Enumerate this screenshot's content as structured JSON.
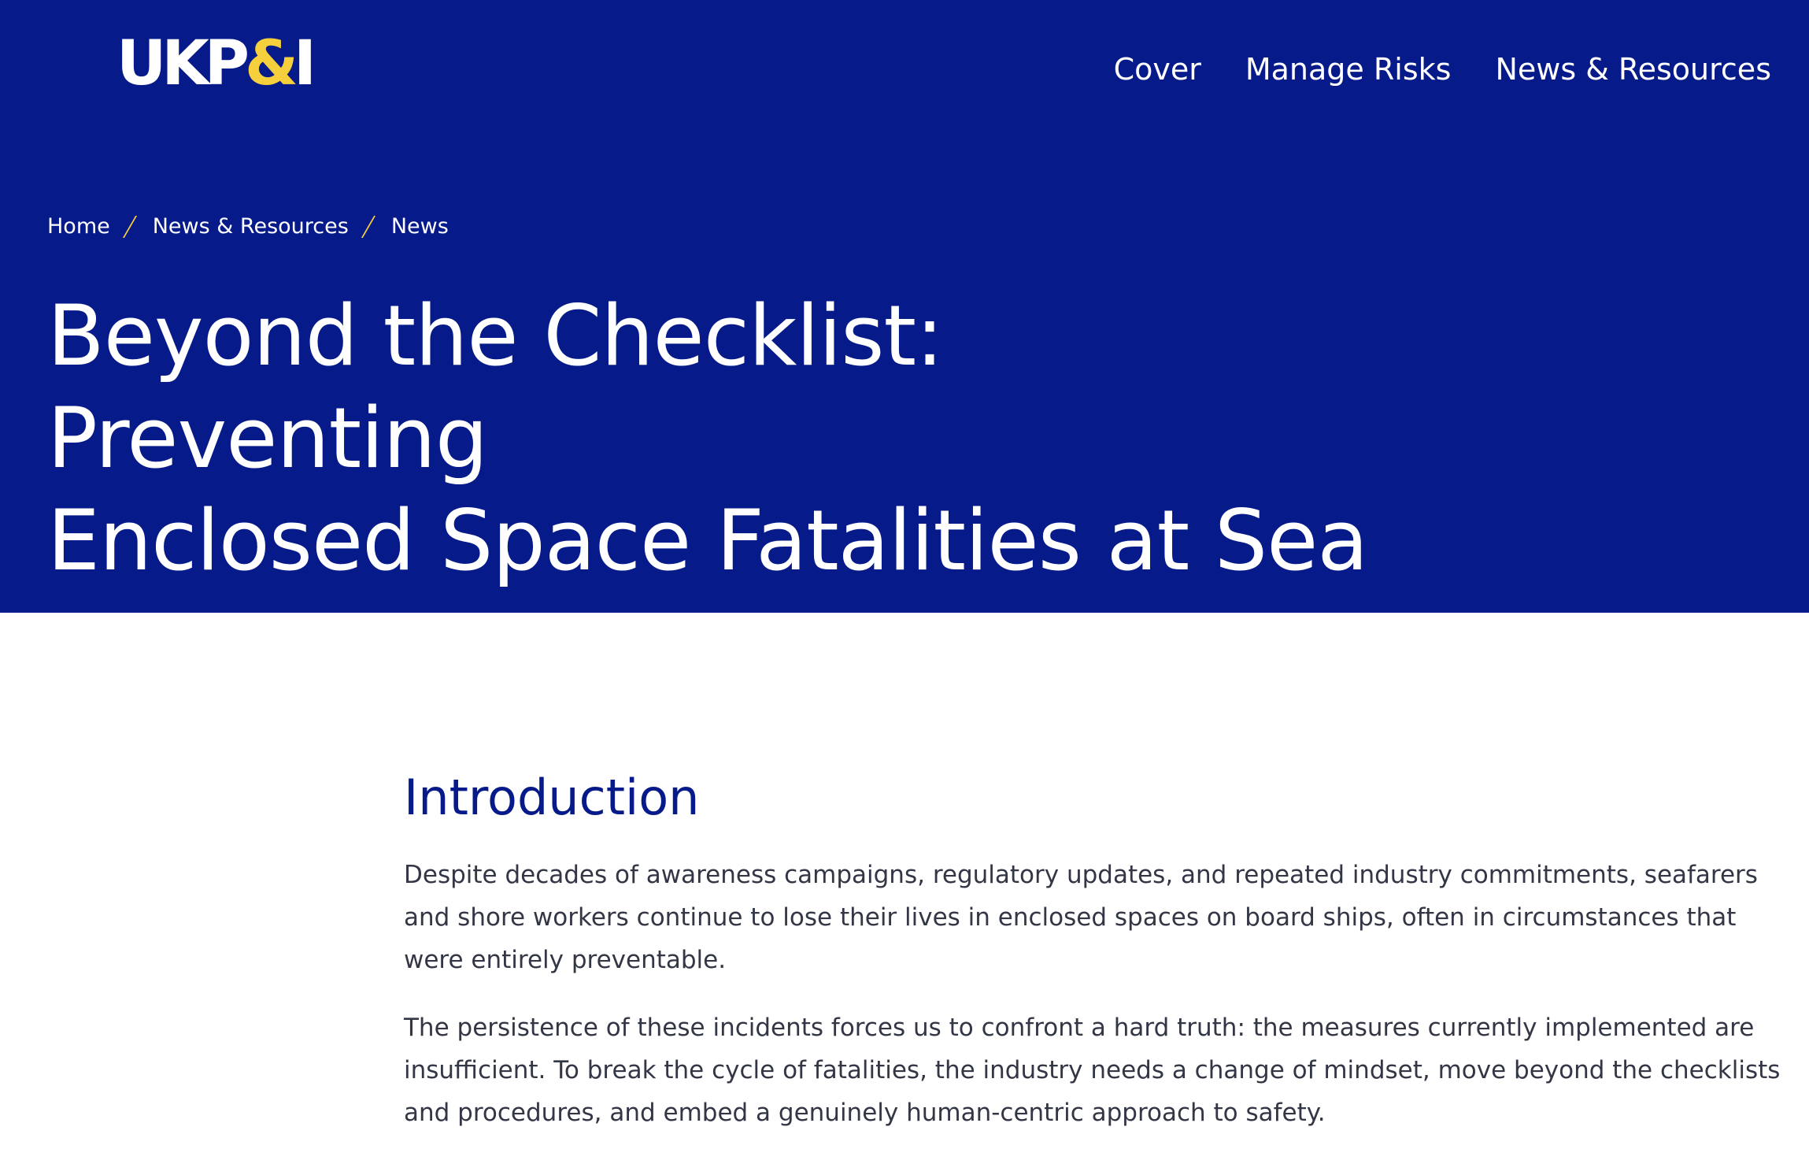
{
  "header": {
    "logo": {
      "part1": "UKP",
      "part2": "&",
      "part3": "I"
    },
    "nav": [
      "Cover",
      "Manage Risks",
      "News & Resources"
    ]
  },
  "breadcrumb": [
    "Home",
    "News & Resources",
    "News"
  ],
  "article": {
    "title_line1": "Beyond the Checklist: Preventing",
    "title_line2": "Enclosed Space Fatalities at Sea",
    "section_heading": "Introduction",
    "paragraphs": [
      "Despite decades of awareness campaigns, regulatory updates, and repeated industry commitments, seafarers and shore workers continue to lose their lives in enclosed spaces on board ships, often in circumstances that were entirely preventable.",
      "The persistence of these incidents forces us to confront a hard truth: the measures currently implemented are insufficient. To break the cycle of fatalities, the industry needs a change of mindset, move beyond the checklists and procedures, and embed a genuinely human-centric approach to safety."
    ]
  },
  "colors": {
    "brand_blue": "#061a8a",
    "accent_yellow": "#f5cf3c",
    "body_text": "#333645"
  }
}
